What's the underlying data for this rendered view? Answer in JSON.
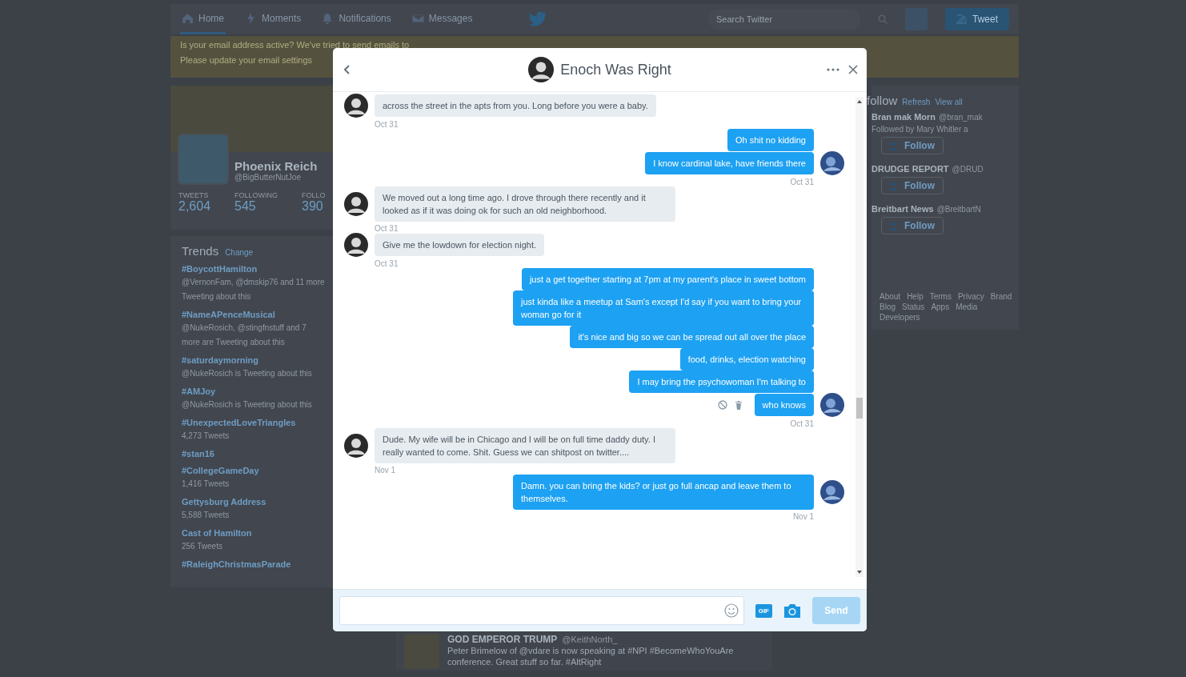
{
  "nav": {
    "items": [
      {
        "label": "Home",
        "selected": true
      },
      {
        "label": "Moments",
        "selected": false
      },
      {
        "label": "Notifications",
        "selected": false
      },
      {
        "label": "Messages",
        "selected": false
      }
    ],
    "search": {
      "placeholder": "Search Twitter"
    },
    "tweet_button": "Tweet"
  },
  "email_banner": {
    "line_1": "Is your email address active? We've tried to send emails to",
    "line_2": "Please update your email settings"
  },
  "profile": {
    "name": "Phoenix Reich",
    "handle": "@BigButterNutJoe",
    "stats": [
      {
        "label": "TWEETS",
        "value": "2,604"
      },
      {
        "label": "FOLLOWING",
        "value": "545"
      },
      {
        "label": "FOLLO",
        "value": "390"
      }
    ]
  },
  "trends": {
    "title": "Trends",
    "change": "Change",
    "items": [
      {
        "name": "#BoycottHamilton",
        "detail": "@VernonFam, @dmskip76 and 11 more Tweeting about this"
      },
      {
        "name": "#NameAPenceMusical",
        "detail": "@NukeRosich, @stingfnstuff and 7 more are Tweeting about this"
      },
      {
        "name": "#saturdaymorning",
        "detail": "@NukeRosich is Tweeting about this"
      },
      {
        "name": "#AMJoy",
        "detail": "@NukeRosich is Tweeting about this"
      },
      {
        "name": "#UnexpectedLoveTriangles",
        "detail": "4,273 Tweets"
      },
      {
        "name": "#stan16"
      },
      {
        "name": "#CollegeGameDay",
        "detail": "1,416 Tweets"
      },
      {
        "name": "Gettysburg Address",
        "detail": "5,588 Tweets"
      },
      {
        "name": "Cast of Hamilton",
        "detail": "256 Tweets"
      },
      {
        "name": "#RaleighChristmasParade"
      }
    ]
  },
  "who_to_follow": {
    "title": "follow",
    "links": [
      "Refresh",
      "View all"
    ],
    "accounts": [
      {
        "name": "Bran mak Morn",
        "handle": "@bran_mak",
        "note": "Followed by Mary Whitler a",
        "button": "Follow"
      },
      {
        "name": "DRUDGE REPORT",
        "handle": "@DRUD",
        "button": "Follow"
      },
      {
        "name": "Breitbart News",
        "handle": "@BreitbartN",
        "button": "Follow"
      }
    ]
  },
  "footer_links": [
    "About",
    "Help",
    "Terms",
    "Privacy",
    "Brand",
    "Blog",
    "Status",
    "Apps",
    "Media",
    "Developers"
  ],
  "timeline_tweet": {
    "name": "GOD EMPEROR TRUMP",
    "handle": "@KeithNorth_",
    "text": "Peter Brimelow of @vdare is now speaking at #NPI #BecomeWhoYouAre conference. Great stuff so far. #AltRight"
  },
  "conversation": {
    "title": "Enoch Was Right",
    "messages": [
      {
        "kind": "received",
        "text": "across the street in the apts from you. Long before you were a baby.",
        "avatar": true,
        "date": "Oct 31"
      },
      {
        "kind": "sent",
        "text": "Oh shit no kidding",
        "avatar": false
      },
      {
        "kind": "sent",
        "text": "I know cardinal lake, have friends there",
        "avatar": true,
        "date": "Oct 31"
      },
      {
        "kind": "received",
        "text": "We moved out a long time ago. I drove through there recently and it looked as if it was doing ok for such an old neighborhood.",
        "avatar": true,
        "date": "Oct 31"
      },
      {
        "kind": "received",
        "text": "Give me the lowdown for election night.",
        "avatar": true,
        "date": "Oct 31"
      },
      {
        "kind": "sent",
        "text": "just a get together starting at 7pm at my parent's place in sweet bottom",
        "avatar": false
      },
      {
        "kind": "sent",
        "text": "just kinda like a meetup at Sam's except I'd say if you want to bring your woman go for it",
        "avatar": false
      },
      {
        "kind": "sent",
        "text": "it's nice and big so we can be spread out all over the place",
        "avatar": false
      },
      {
        "kind": "sent",
        "text": "food, drinks, election watching",
        "avatar": false
      },
      {
        "kind": "sent",
        "text": "I may bring the psychowoman I'm talking to",
        "avatar": false
      },
      {
        "kind": "sent",
        "text": "who knows",
        "avatar": true,
        "date": "Oct 31",
        "hover_actions": true
      },
      {
        "kind": "received",
        "text": "Dude. My wife will be in Chicago and I will be on full time daddy duty. I really wanted to come. Shit. Guess we can shitpost on twitter....",
        "avatar": true,
        "date": "Nov 1"
      },
      {
        "kind": "sent",
        "text": "Damn. you can bring the kids? or just go full ancap and leave them to themselves.",
        "avatar": true,
        "date": "Nov 1"
      }
    ],
    "composer": {
      "gif": "GIF",
      "send": {
        "label": "Send",
        "disabled": true
      }
    }
  }
}
